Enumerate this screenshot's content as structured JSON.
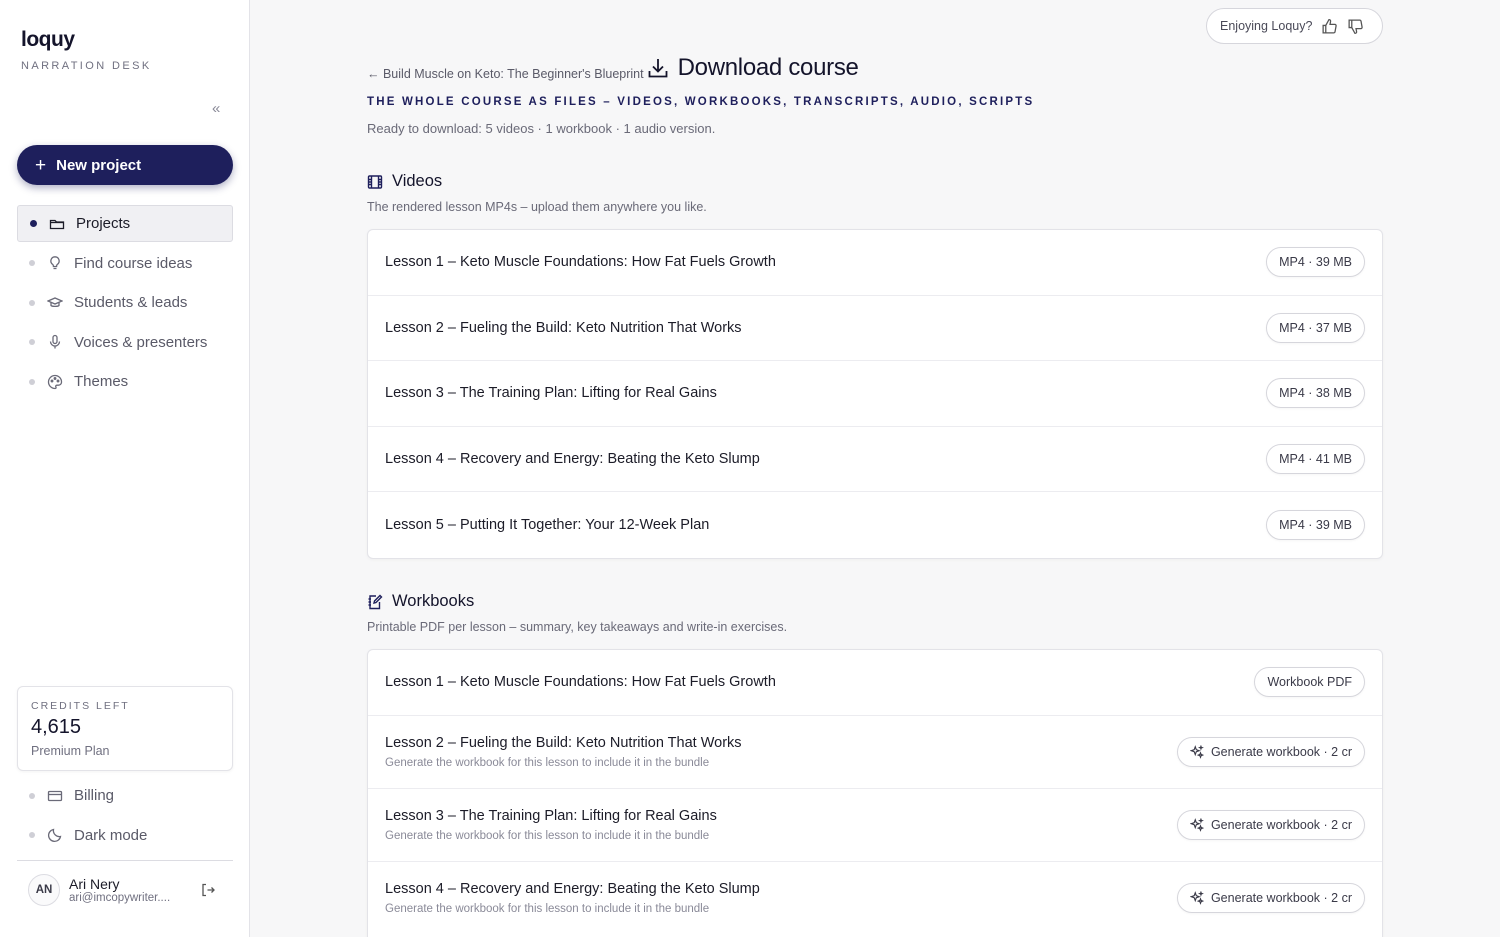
{
  "app": {
    "brand": "loquy",
    "brand_subtitle": "NARRATION DESK",
    "collapse_label": "«"
  },
  "sidebar": {
    "new_project_label": "New project",
    "items": [
      {
        "label": "Projects",
        "icon": "folder-icon",
        "active": true
      },
      {
        "label": "Find course ideas",
        "icon": "lightbulb-icon"
      },
      {
        "label": "Students & leads",
        "icon": "graduation-cap-icon"
      },
      {
        "label": "Voices & presenters",
        "icon": "microphone-icon"
      },
      {
        "label": "Themes",
        "icon": "palette-icon"
      }
    ],
    "credits": {
      "label": "CREDITS LEFT",
      "value": "4,615",
      "plan": "Premium Plan"
    },
    "bottom_items": [
      {
        "label": "Billing",
        "icon": "credit-card-icon"
      },
      {
        "label": "Dark mode",
        "icon": "moon-icon"
      }
    ],
    "user": {
      "initials": "AN",
      "name": "Ari Nery",
      "email": "ari@imcopywriter...."
    }
  },
  "feedback": {
    "label": "Enjoying Loquy?"
  },
  "header": {
    "back_link": "← Build Muscle on Keto: The Beginner's Blueprint",
    "title": "Download course",
    "eyebrow": "THE WHOLE COURSE AS FILES – VIDEOS, WORKBOOKS, TRANSCRIPTS, AUDIO, SCRIPTS",
    "ready": "Ready to download: 5 videos · 1 workbook · 1 audio version."
  },
  "videos": {
    "title": "Videos",
    "description": "The rendered lesson MP4s – upload them anywhere you like.",
    "items": [
      {
        "title": "Lesson 1 – Keto Muscle Foundations: How Fat Fuels Growth",
        "badge": "MP4 · 39 MB"
      },
      {
        "title": "Lesson 2 – Fueling the Build: Keto Nutrition That Works",
        "badge": "MP4 · 37 MB"
      },
      {
        "title": "Lesson 3 – The Training Plan: Lifting for Real Gains",
        "badge": "MP4 · 38 MB"
      },
      {
        "title": "Lesson 4 – Recovery and Energy: Beating the Keto Slump",
        "badge": "MP4 · 41 MB"
      },
      {
        "title": "Lesson 5 – Putting It Together: Your 12-Week Plan",
        "badge": "MP4 · 39 MB"
      }
    ]
  },
  "workbooks": {
    "title": "Workbooks",
    "description": "Printable PDF per lesson – summary, key takeaways and write-in exercises.",
    "items": [
      {
        "title": "Lesson 1 – Keto Muscle Foundations: How Fat Fuels Growth",
        "sub": "",
        "action": "Workbook PDF",
        "generate": false
      },
      {
        "title": "Lesson 2 – Fueling the Build: Keto Nutrition That Works",
        "sub": "Generate the workbook for this lesson to include it in the bundle",
        "action": "Generate workbook · 2 cr",
        "generate": true
      },
      {
        "title": "Lesson 3 – The Training Plan: Lifting for Real Gains",
        "sub": "Generate the workbook for this lesson to include it in the bundle",
        "action": "Generate workbook · 2 cr",
        "generate": true
      },
      {
        "title": "Lesson 4 – Recovery and Energy: Beating the Keto Slump",
        "sub": "Generate the workbook for this lesson to include it in the bundle",
        "action": "Generate workbook · 2 cr",
        "generate": true
      }
    ]
  }
}
